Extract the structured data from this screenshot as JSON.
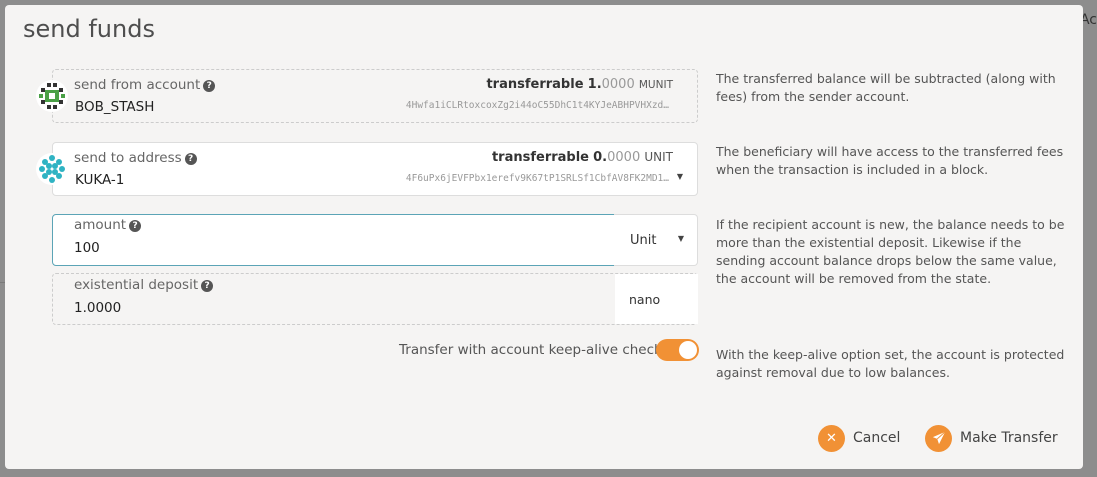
{
  "modal": {
    "title": "send funds"
  },
  "backdrop": {
    "corner_text": "Ac"
  },
  "from": {
    "label": "send from account",
    "name": "BOB_STASH",
    "transferrable_label": "transferrable",
    "transferrable_int": "1.",
    "transferrable_dec": "0000",
    "transferrable_unit": "MUNIT",
    "address": "4Hwfa1iCLRtoxcoxZg2i44oC55DhC1t4KYJeABHPVHXzd…",
    "description": "The transferred balance will be subtracted (along with fees) from the sender account."
  },
  "to": {
    "label": "send to address",
    "name": "KUKA-1",
    "transferrable_label": "transferrable",
    "transferrable_int": "0.",
    "transferrable_dec": "0000",
    "transferrable_unit": "UNIT",
    "address": "4F6uPx6jEVFPbx1erefv9K67tP1SRLSf1CbfAV8FK2MD1…",
    "description": "The beneficiary will have access to the transferred fees when the transaction is included in a block."
  },
  "amount": {
    "label": "amount",
    "value": "100",
    "unit": "Unit",
    "description": "If the recipient account is new, the balance needs to be more than the existential deposit. Likewise if the sending account balance drops below the same value, the account will be removed from the state."
  },
  "existential": {
    "label": "existential deposit",
    "value": "1.0000",
    "unit": "nano"
  },
  "keepalive": {
    "label": "Transfer with account keep-alive checks",
    "enabled": true,
    "description": "With the keep-alive option set, the account is protected against removal due to low balances."
  },
  "actions": {
    "cancel": "Cancel",
    "confirm": "Make Transfer"
  },
  "colors": {
    "accent": "#f19135",
    "focus_border": "#5ba4b6"
  }
}
